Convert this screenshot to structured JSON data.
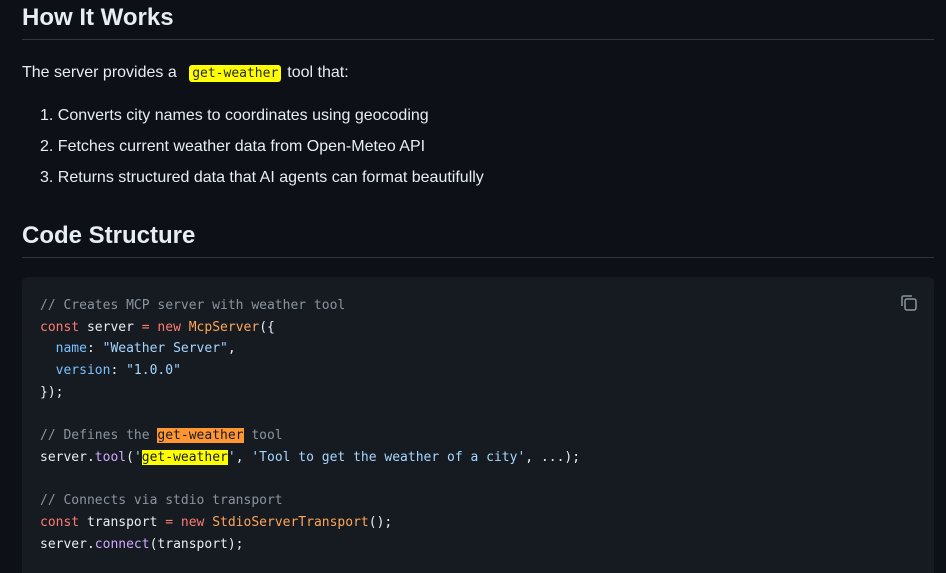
{
  "how": {
    "title": "How It Works",
    "intro_before": "The server provides a ",
    "intro_code": "get-weather",
    "intro_after": "tool that:",
    "steps": [
      "1. Converts city names to coordinates using geocoding",
      "2. Fetches current weather data from Open-Meteo API",
      "3. Returns structured data that AI agents can format beautifully"
    ]
  },
  "code": {
    "title": "Code Structure",
    "copy_icon": "copy-icon",
    "lines": {
      "l1": "// Creates MCP server with weather tool",
      "l2_kw": "const",
      "l2_var": " server ",
      "l2_op": "=",
      "l2_new": " new ",
      "l2_cls": "McpServer",
      "l2_end": "({",
      "l3_prop": "name",
      "l3_colon": ": ",
      "l3_str": "\"Weather Server\"",
      "l3_end": ",",
      "l4_prop": "version",
      "l4_colon": ": ",
      "l4_str": "\"1.0.0\"",
      "l5": "});",
      "l7_a": "// Defines the ",
      "l7_mark": "get-weather",
      "l7_b": " tool",
      "l8_a": "server.",
      "l8_fn": "tool",
      "l8_b": "(",
      "l8_q1": "'",
      "l8_mark": "get-weather",
      "l8_q2": "'",
      "l8_c": ", ",
      "l8_str": "'Tool to get the weather of a city'",
      "l8_d": ", ...);",
      "l10": "// Connects via stdio transport",
      "l11_kw": "const",
      "l11_var": " transport ",
      "l11_op": "=",
      "l11_new": " new ",
      "l11_cls": "StdioServerTransport",
      "l11_end": "();",
      "l12_a": "server.",
      "l12_fn": "connect",
      "l12_b": "(transport);"
    }
  }
}
